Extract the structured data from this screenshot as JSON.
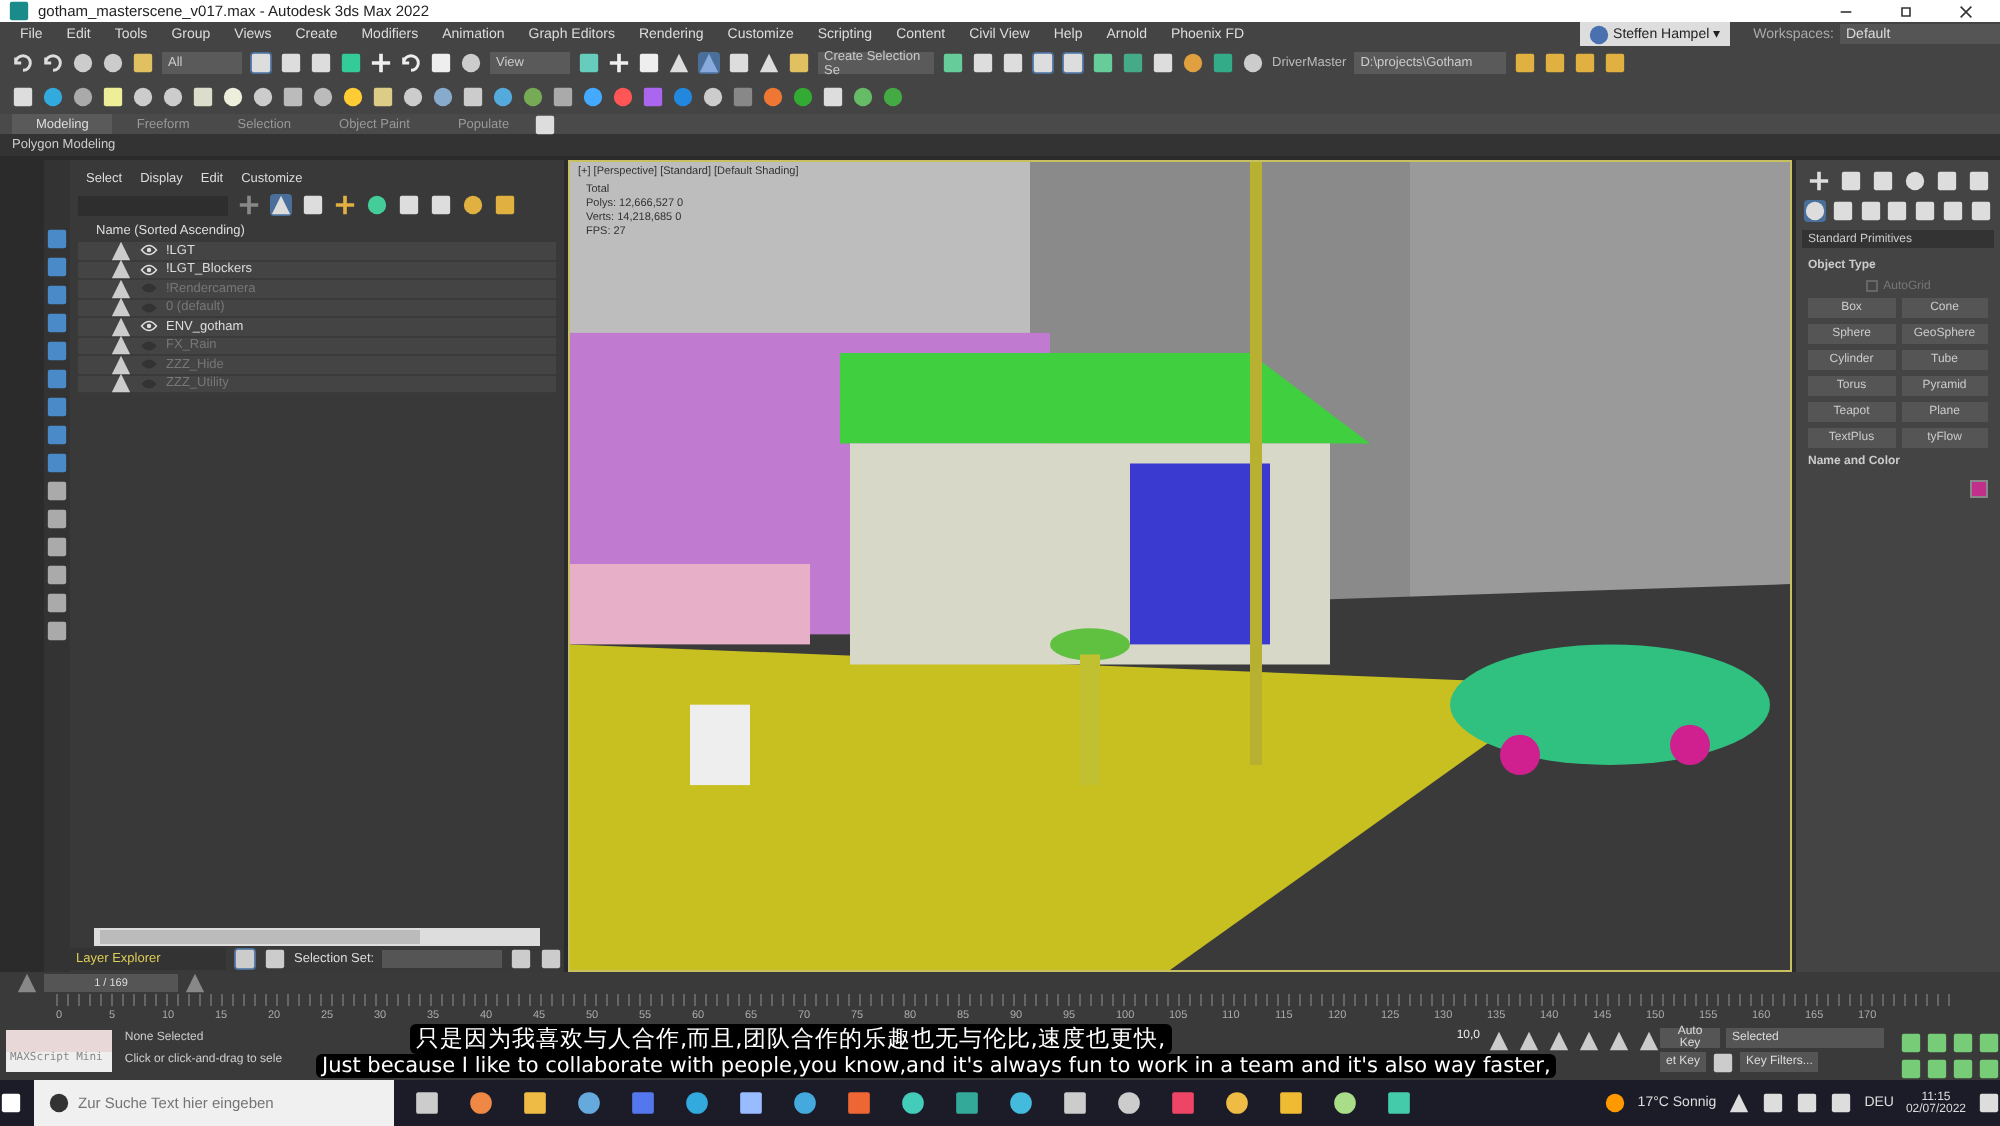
{
  "window": {
    "title": "gotham_masterscene_v017.max - Autodesk 3ds Max 2022"
  },
  "menu": [
    "File",
    "Edit",
    "Tools",
    "Group",
    "Views",
    "Create",
    "Modifiers",
    "Animation",
    "Graph Editors",
    "Rendering",
    "Customize",
    "Scripting",
    "Content",
    "Civil View",
    "Help",
    "Arnold",
    "Phoenix FD"
  ],
  "user": {
    "name": "Steffen Hampel",
    "caret": "▾"
  },
  "workspaces": {
    "label": "Workspaces:",
    "value": "Default"
  },
  "toolbar": {
    "selection_filter": "All",
    "reference_coord": "View",
    "selection_set_placeholder": "Create Selection Se",
    "driver": "DriverMaster",
    "project_path": "D:\\projects\\Gotham"
  },
  "ribbon": {
    "tabs": [
      {
        "label": "Modeling",
        "selected": true
      },
      {
        "label": "Freeform",
        "selected": false
      },
      {
        "label": "Selection",
        "selected": false
      },
      {
        "label": "Object Paint",
        "selected": false
      },
      {
        "label": "Populate",
        "selected": false
      }
    ],
    "panel": "Polygon Modeling"
  },
  "scene_explorer": {
    "menu": [
      "Select",
      "Display",
      "Edit",
      "Customize"
    ],
    "header": "Name (Sorted Ascending)",
    "layers": [
      {
        "name": "!LGT",
        "visible": true
      },
      {
        "name": "!LGT_Blockers",
        "visible": true
      },
      {
        "name": "!Rendercamera",
        "visible": false
      },
      {
        "name": "0 (default)",
        "visible": false
      },
      {
        "name": "ENV_gotham",
        "visible": true
      },
      {
        "name": "FX_Rain",
        "visible": false
      },
      {
        "name": "ZZZ_Hide",
        "visible": false
      },
      {
        "name": "ZZZ_Utility",
        "visible": false
      }
    ],
    "mode": "Layer Explorer",
    "selection_set_label": "Selection Set:"
  },
  "viewport": {
    "label": "[+] [Perspective] [Standard] [Default Shading]",
    "stats": [
      {
        "label": "Total"
      },
      {
        "label": "Polys:",
        "value": "12,666,527  0"
      },
      {
        "label": "Verts:",
        "value": "14,218,685  0"
      },
      {
        "label": "FPS:",
        "value": "27"
      }
    ]
  },
  "command_panel": {
    "dropdown": "Standard Primitives",
    "object_type": {
      "title": "Object Type",
      "autogrid": {
        "label": "AutoGrid",
        "checked": false
      },
      "buttons": [
        "Box",
        "Cone",
        "Sphere",
        "GeoSphere",
        "Cylinder",
        "Tube",
        "Torus",
        "Pyramid",
        "Teapot",
        "Plane",
        "TextPlus",
        "tyFlow"
      ]
    },
    "name_and_color": {
      "title": "Name and Color",
      "color": "#c0308a"
    }
  },
  "timeline": {
    "frame": "1 / 169",
    "level": 1,
    "ticks": [
      "0",
      "5",
      "10",
      "15",
      "20",
      "25",
      "30",
      "35",
      "40",
      "45",
      "50",
      "55",
      "60",
      "65",
      "70",
      "75",
      "80",
      "85",
      "90",
      "95",
      "100",
      "105",
      "110",
      "115",
      "120",
      "125",
      "130",
      "135",
      "140",
      "145",
      "150",
      "155",
      "160",
      "165",
      "170"
    ]
  },
  "status": {
    "maxscript": "MAXScript Mini",
    "selection": "None Selected",
    "prompt": "Click or click-and-drag to sele",
    "time": "10,0",
    "auto_key": "Auto Key",
    "set_key": "et Key",
    "key_mode": "Selected",
    "key_filters": "Key Filters..."
  },
  "taskbar": {
    "search_placeholder": "Zur Suche Text hier eingeben",
    "weather": "17°C Sonnig",
    "language": "DEU",
    "time": "11:15",
    "date": "02/07/2022"
  },
  "subtitles": [
    "只是因为我喜欢与人合作,而且,团队合作的乐趣也无与伦比,速度也更快,",
    "Just because I like to collaborate with people,you know,and it's always fun to work in a team and it's also way faster,"
  ]
}
